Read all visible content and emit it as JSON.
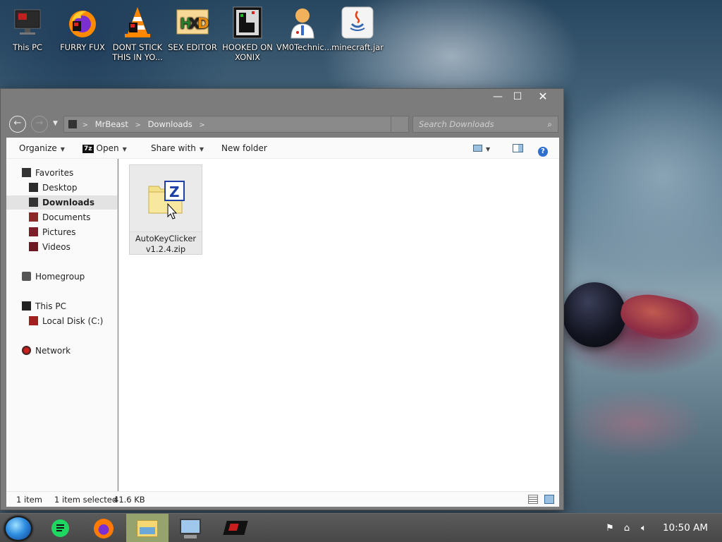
{
  "desktop": {
    "icons": [
      {
        "label": "This PC",
        "icon": "monitor-icon"
      },
      {
        "label": "FURRY FUX",
        "icon": "firefox-icon"
      },
      {
        "label": "DONT STICK THIS IN YO...",
        "icon": "vlc-cone-icon"
      },
      {
        "label": "SEX EDITOR",
        "icon": "hxd-editor-icon"
      },
      {
        "label": "HOOKED ON XONIX",
        "icon": "xonix-game-icon"
      },
      {
        "label": "VM0Technic...",
        "icon": "doctor-avatar-icon"
      },
      {
        "label": "minecraft.jar",
        "icon": "java-icon"
      }
    ]
  },
  "window": {
    "controls": {
      "minimize": "—",
      "maximize": "☐",
      "close": "✕"
    },
    "breadcrumb": [
      "MrBeast",
      "Downloads"
    ],
    "breadcrumb_sep": ">",
    "search_placeholder": "Search Downloads",
    "toolbar": {
      "organize": "Organize",
      "open": "Open",
      "open_badge": "7z",
      "share_with": "Share with",
      "new_folder": "New folder"
    },
    "nav": {
      "favorites": "Favorites",
      "desktop": "Desktop",
      "downloads": "Downloads",
      "documents": "Documents",
      "pictures": "Pictures",
      "videos": "Videos",
      "homegroup": "Homegroup",
      "this_pc": "This PC",
      "local_disk": "Local Disk (C:)",
      "network": "Network"
    },
    "files": [
      {
        "name_line1": "AutoKeyClicker",
        "name_line2": "v1.2.4.zip",
        "icon": "zip-archive-icon"
      }
    ],
    "status": {
      "count": "1 item",
      "selected": "1 item selected",
      "size": "41.6 KB"
    }
  },
  "taskbar": {
    "apps": [
      "notes-app-icon",
      "firefox-icon",
      "file-explorer-icon",
      "remote-desktop-icon",
      "red-app-icon"
    ],
    "clock": "10:50 AM"
  },
  "colors": {
    "window_frame": "#7c7c7c",
    "selection": "#e3e3e3",
    "active_taskbar": "#96a36c"
  }
}
